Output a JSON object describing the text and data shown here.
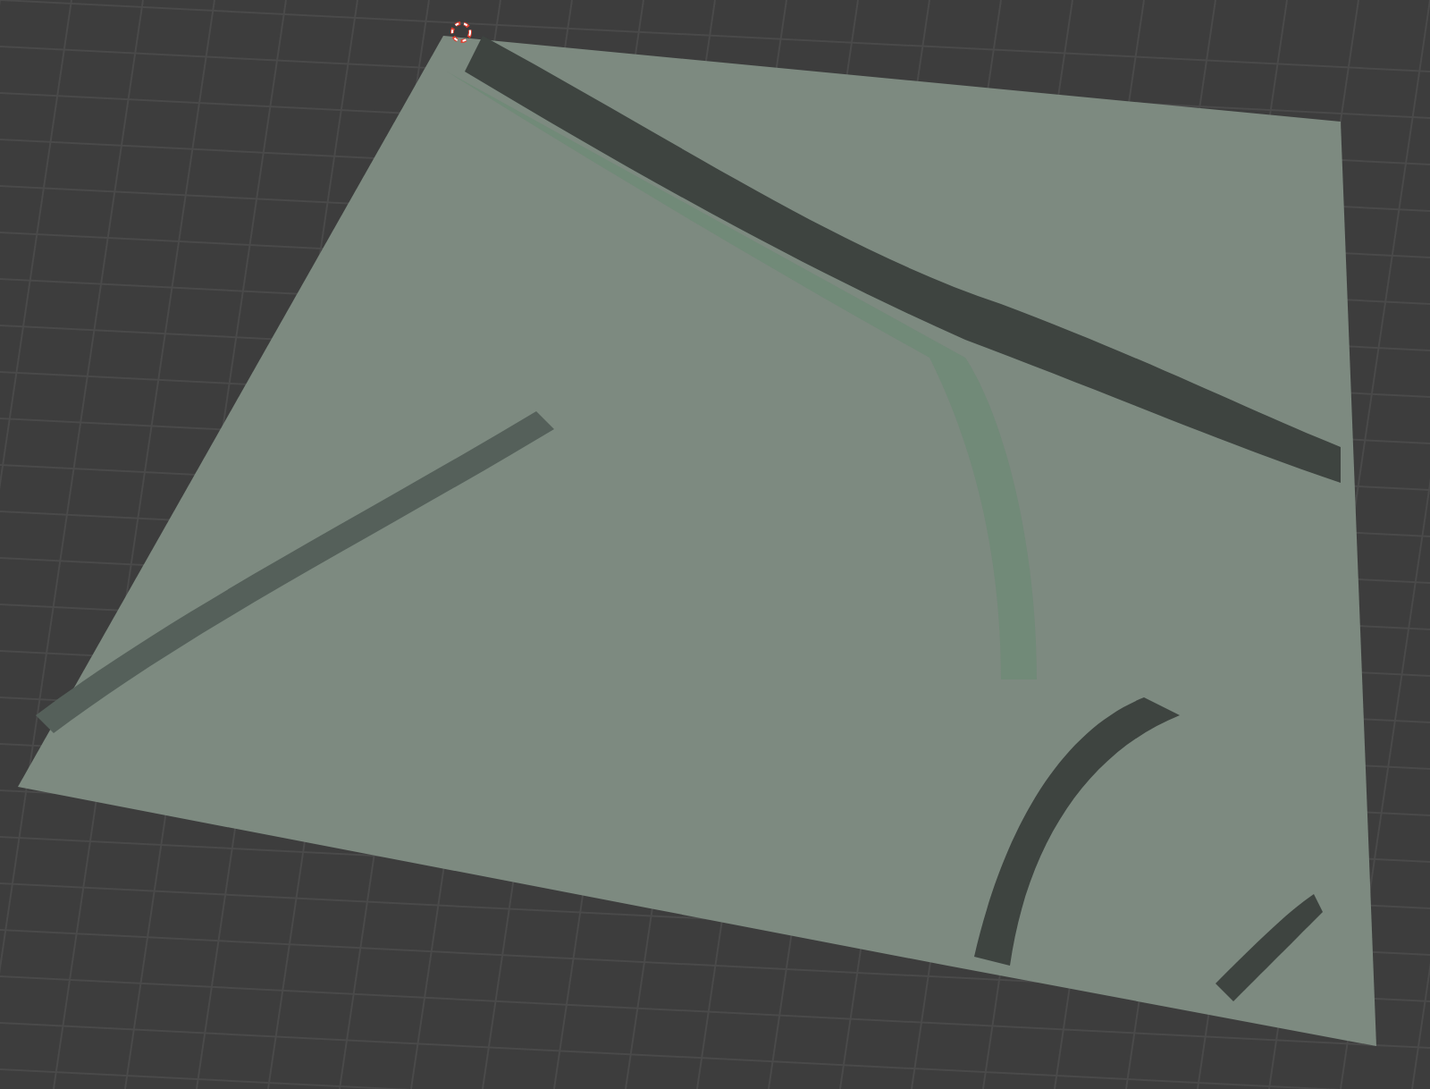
{
  "viewport": {
    "show_grid": true,
    "show_cursor": true
  }
}
